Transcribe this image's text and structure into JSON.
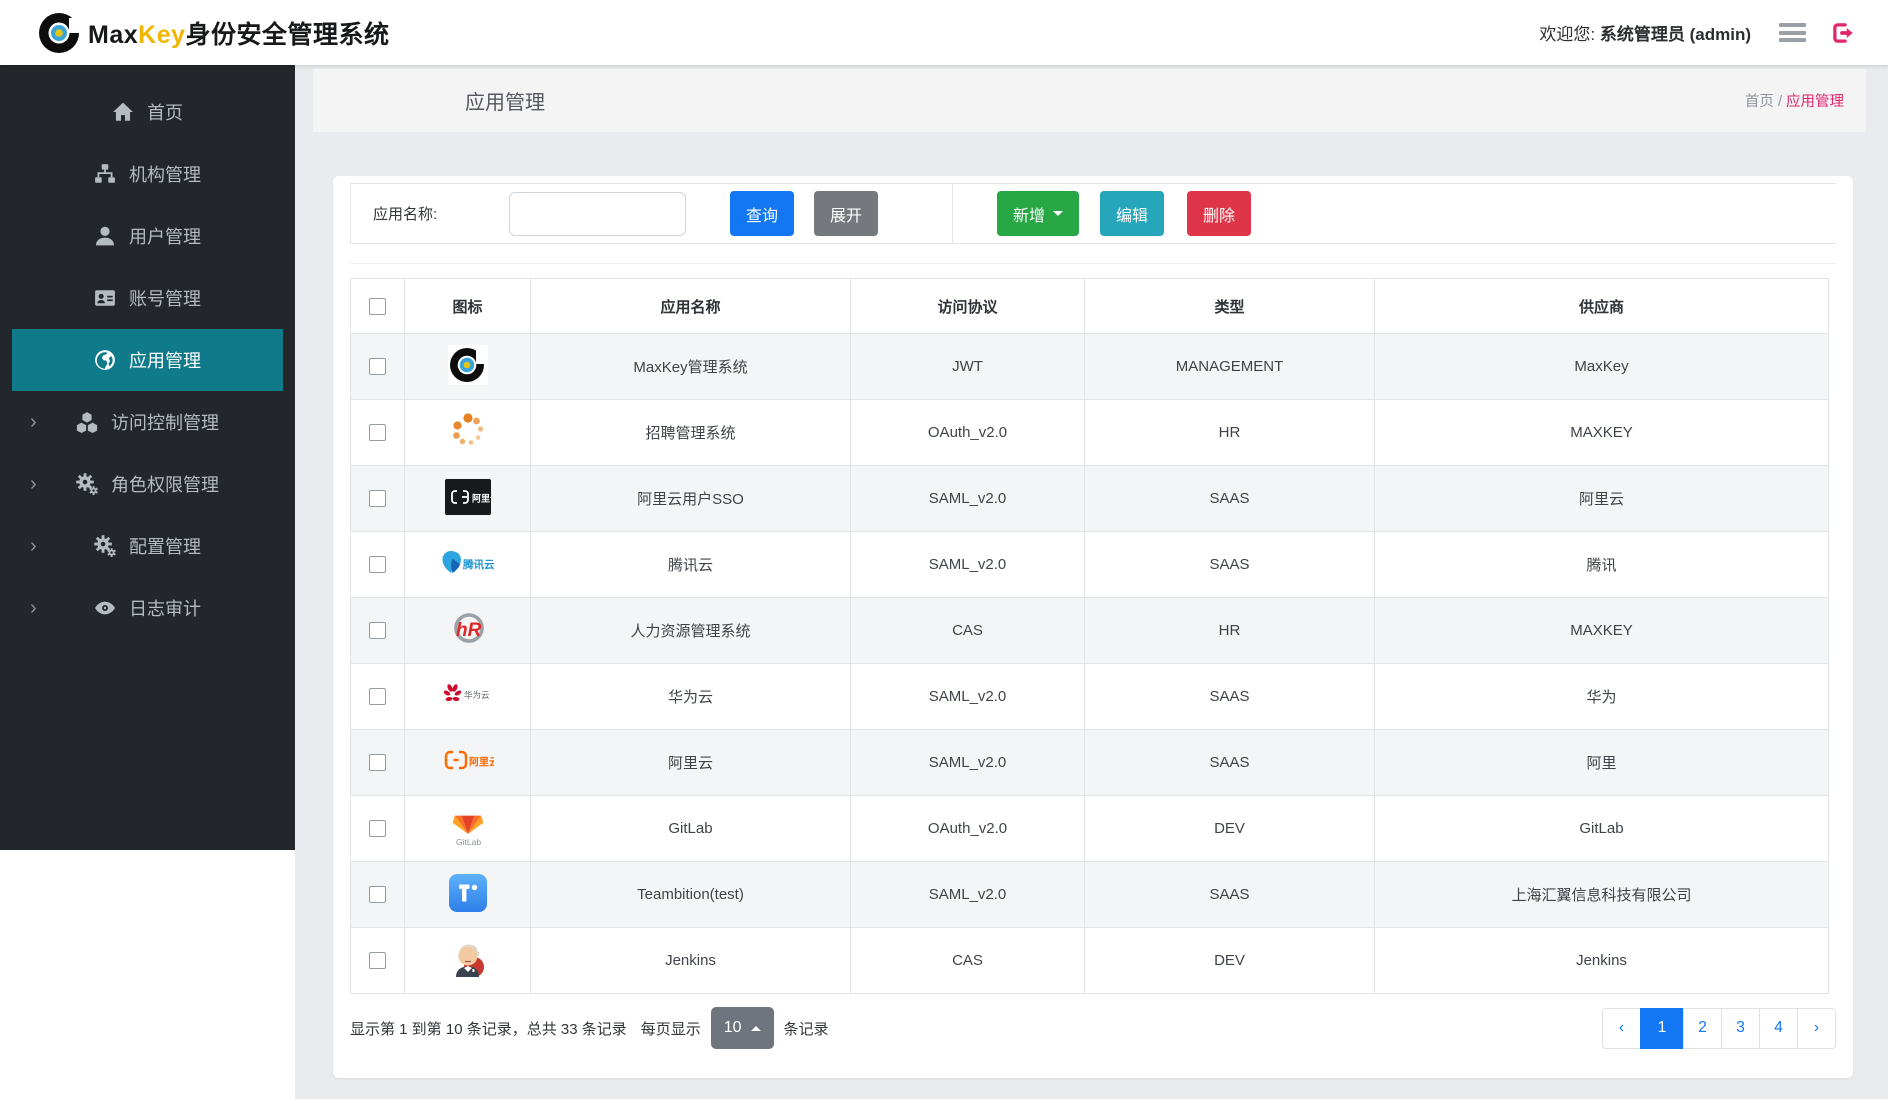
{
  "header": {
    "brand_prefix": "Max",
    "brand_accent": "Key",
    "brand_suffix": "身份安全管理系统",
    "welcome_label": "欢迎您:",
    "user_name": "系统管理员 (admin)"
  },
  "sidebar": {
    "items": [
      {
        "id": "home",
        "label": "首页",
        "icon": "home-icon",
        "active": false,
        "expandable": false
      },
      {
        "id": "org",
        "label": "机构管理",
        "icon": "sitemap-icon",
        "active": false,
        "expandable": false
      },
      {
        "id": "user",
        "label": "用户管理",
        "icon": "user-icon",
        "active": false,
        "expandable": false
      },
      {
        "id": "account",
        "label": "账号管理",
        "icon": "id-card-icon",
        "active": false,
        "expandable": false
      },
      {
        "id": "app",
        "label": "应用管理",
        "icon": "globe-icon",
        "active": true,
        "expandable": false
      },
      {
        "id": "access",
        "label": "访问控制管理",
        "icon": "cubes-icon",
        "active": false,
        "expandable": true
      },
      {
        "id": "role",
        "label": "角色权限管理",
        "icon": "gears-icon",
        "active": false,
        "expandable": true
      },
      {
        "id": "config",
        "label": "配置管理",
        "icon": "gears-icon",
        "active": false,
        "expandable": true
      },
      {
        "id": "audit",
        "label": "日志审计",
        "icon": "eye-icon",
        "active": false,
        "expandable": true
      }
    ],
    "expand_glyph": "›"
  },
  "page": {
    "title": "应用管理",
    "breadcrumb_home": "首页",
    "breadcrumb_sep": "/",
    "breadcrumb_current": "应用管理"
  },
  "toolbar": {
    "search_label": "应用名称:",
    "search_value": "",
    "query_label": "查询",
    "expand_label": "展开",
    "add_label": "新增",
    "edit_label": "编辑",
    "delete_label": "删除"
  },
  "table": {
    "columns": [
      "图标",
      "应用名称",
      "访问协议",
      "类型",
      "供应商"
    ],
    "rows": [
      {
        "icon": "maxkey-logo-icon",
        "name": "MaxKey管理系统",
        "protocol": "JWT",
        "type": "MANAGEMENT",
        "vendor": "MaxKey"
      },
      {
        "icon": "recruit-dots-icon",
        "name": "招聘管理系统",
        "protocol": "OAuth_v2.0",
        "type": "HR",
        "vendor": "MAXKEY"
      },
      {
        "icon": "aliyun-dark-icon",
        "name": "阿里云用户SSO",
        "protocol": "SAML_v2.0",
        "type": "SAAS",
        "vendor": "阿里云"
      },
      {
        "icon": "tencent-cloud-icon",
        "name": "腾讯云",
        "protocol": "SAML_v2.0",
        "type": "SAAS",
        "vendor": "腾讯"
      },
      {
        "icon": "hr-logo-icon",
        "name": "人力资源管理系统",
        "protocol": "CAS",
        "type": "HR",
        "vendor": "MAXKEY"
      },
      {
        "icon": "huawei-cloud-icon",
        "name": "华为云",
        "protocol": "SAML_v2.0",
        "type": "SAAS",
        "vendor": "华为"
      },
      {
        "icon": "aliyun-orange-icon",
        "name": "阿里云",
        "protocol": "SAML_v2.0",
        "type": "SAAS",
        "vendor": "阿里"
      },
      {
        "icon": "gitlab-icon",
        "name": "GitLab",
        "protocol": "OAuth_v2.0",
        "type": "DEV",
        "vendor": "GitLab"
      },
      {
        "icon": "teambition-icon",
        "name": "Teambition(test)",
        "protocol": "SAML_v2.0",
        "type": "SAAS",
        "vendor": "上海汇翼信息科技有限公司"
      },
      {
        "icon": "jenkins-icon",
        "name": "Jenkins",
        "protocol": "CAS",
        "type": "DEV",
        "vendor": "Jenkins"
      }
    ]
  },
  "footer": {
    "summary": "显示第 1 到第 10 条记录，总共 33 条记录",
    "page_size_label": "每页显示",
    "page_size_value": "10",
    "page_size_suffix": "条记录",
    "pagination": [
      {
        "label": "‹",
        "active": false
      },
      {
        "label": "1",
        "active": true
      },
      {
        "label": "2",
        "active": false
      },
      {
        "label": "3",
        "active": false
      },
      {
        "label": "4",
        "active": false
      },
      {
        "label": "›",
        "active": false
      }
    ]
  },
  "colors": {
    "sidebar_bg": "#23272c",
    "sidebar_active": "#0e7a8a",
    "primary_blue": "#1376f2",
    "secondary_gray": "#75797e",
    "success_green": "#28a745",
    "info_teal": "#27a5ba",
    "danger_red": "#df3549",
    "brand_pink": "#e0266c",
    "brand_yellow": "#f2b600",
    "stripe_gray": "#f4f5f6"
  }
}
